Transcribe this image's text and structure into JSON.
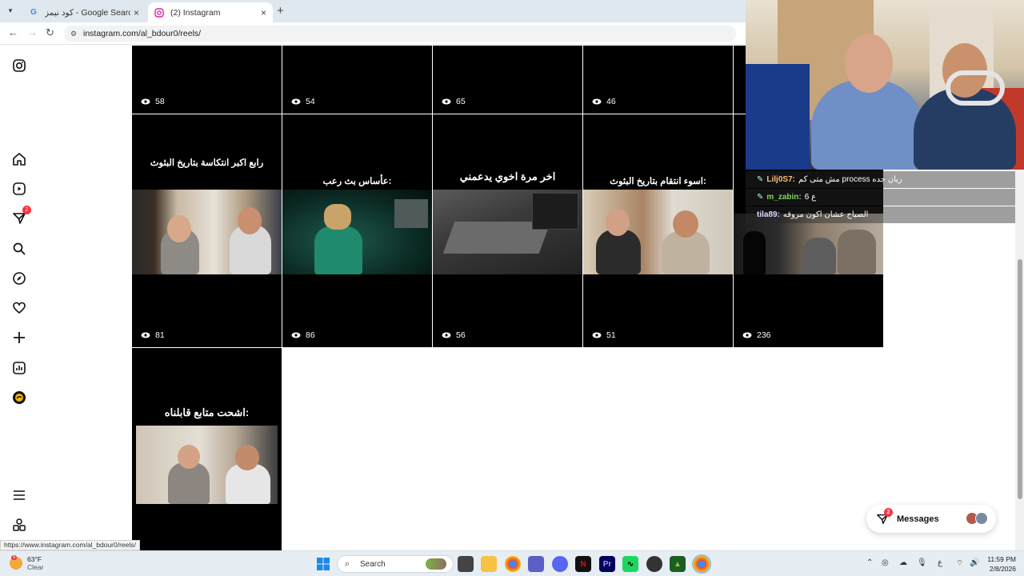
{
  "browser": {
    "tabs": [
      {
        "title": "كود نيمز - Google Search",
        "favicon": "G"
      },
      {
        "title": "(2) Instagram",
        "favicon": "instagram-icon"
      }
    ],
    "url": "instagram.com/al_bdour0/reels/",
    "status_url": "https://www.instagram.com/al_bdour0/reels/"
  },
  "sidebar": {
    "notifications_badge": "2",
    "items": [
      "instagram-logo",
      "home",
      "reels",
      "messages",
      "search",
      "explore",
      "notifications",
      "create",
      "dashboard",
      "profile",
      "more",
      "also-from-meta"
    ]
  },
  "reels": {
    "row1": [
      {
        "views": "58"
      },
      {
        "views": "54"
      },
      {
        "views": "65"
      },
      {
        "views": "46"
      }
    ],
    "row2": [
      {
        "caption": "رابع اكبر انتكاسة بتاريخ البثوث",
        "views": "81"
      },
      {
        "caption": "عأساس بث رعب:",
        "views": "86"
      },
      {
        "caption": "اخر مرة اخوي يدعمني",
        "views": "56"
      },
      {
        "caption": "اسوء انتقام بتاريخ البثوث:",
        "views": "51"
      },
      {
        "caption": "",
        "views": "236"
      }
    ],
    "row3": [
      {
        "caption": "اشحت متابع قابلناه:"
      }
    ]
  },
  "overlay_chat": [
    {
      "user": "Lilj0S7:",
      "text": "مش متى كم process ريان جده"
    },
    {
      "user": "m_zabin:",
      "text": "6 ع"
    },
    {
      "user": "tila89:",
      "text": "الصباح عشان اكون مروقه"
    }
  ],
  "messages_button": {
    "label": "Messages",
    "badge": "2"
  },
  "taskbar": {
    "weather_temp": "63°F",
    "weather_desc": "Clear",
    "weather_badge": "5",
    "search_label": "Search",
    "time": "11:59 PM",
    "date": "2/8/2026",
    "lang": "ع"
  },
  "colors": {
    "instagram_badge": "#ff3040",
    "tile_bg": "#000000"
  }
}
